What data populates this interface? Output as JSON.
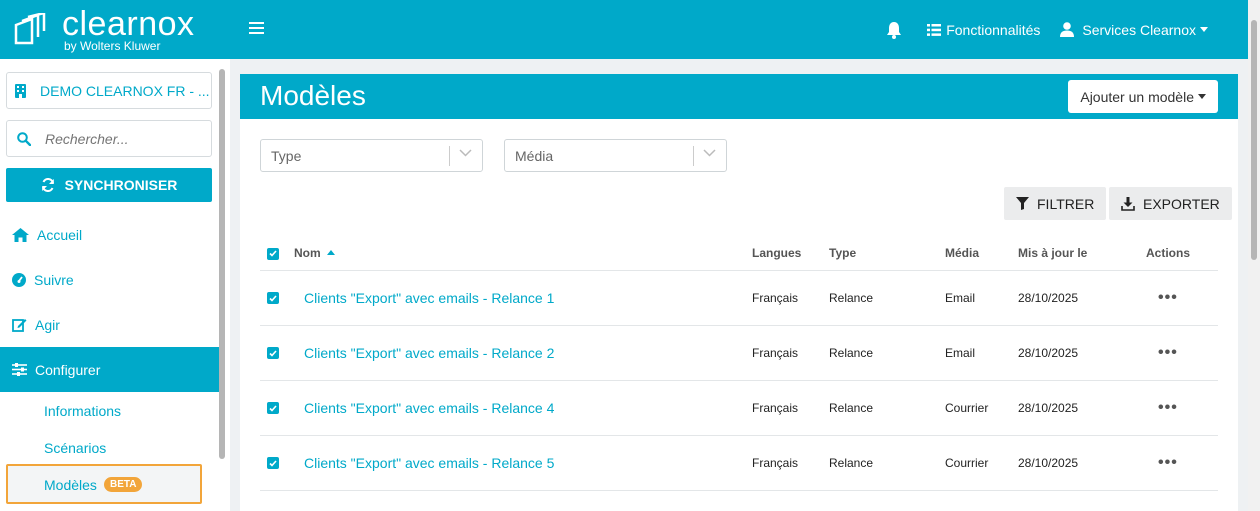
{
  "header": {
    "logo_name": "clearnox",
    "logo_sub": "by Wolters Kluwer",
    "features_label": "Fonctionnalités",
    "user_label": "Services Clearnox"
  },
  "sidebar": {
    "org_label": "DEMO CLEARNOX FR - ...",
    "search_placeholder": "Rechercher...",
    "sync_label": "SYNCHRONISER",
    "nav": [
      {
        "label": "Accueil",
        "icon": "home-icon"
      },
      {
        "label": "Suivre",
        "icon": "gauge-icon"
      },
      {
        "label": "Agir",
        "icon": "edit-icon"
      },
      {
        "label": "Configurer",
        "icon": "sliders-icon"
      }
    ],
    "sub": [
      {
        "label": "Informations"
      },
      {
        "label": "Scénarios"
      },
      {
        "label": "Modèles",
        "badge": "BETA"
      }
    ]
  },
  "main": {
    "title": "Modèles",
    "add_button": "Ajouter un modèle",
    "filters": {
      "type_placeholder": "Type",
      "media_placeholder": "Média"
    },
    "filter_button": "FILTRER",
    "export_button": "EXPORTER",
    "columns": [
      "Nom",
      "Langues",
      "Type",
      "Média",
      "Mis à jour le",
      "Actions"
    ],
    "rows": [
      {
        "name": "Clients \"Export\" avec emails - Relance 1",
        "lang": "Français",
        "type": "Relance",
        "media": "Email",
        "updated": "28/10/2025"
      },
      {
        "name": "Clients \"Export\" avec emails - Relance 2",
        "lang": "Français",
        "type": "Relance",
        "media": "Email",
        "updated": "28/10/2025"
      },
      {
        "name": "Clients \"Export\" avec emails - Relance 4",
        "lang": "Français",
        "type": "Relance",
        "media": "Courrier",
        "updated": "28/10/2025"
      },
      {
        "name": "Clients \"Export\" avec emails - Relance 5",
        "lang": "Français",
        "type": "Relance",
        "media": "Courrier",
        "updated": "28/10/2025"
      }
    ],
    "actions_glyph": "•••"
  },
  "colors": {
    "accent": "#00a9c9",
    "highlight": "#f2a53a"
  }
}
